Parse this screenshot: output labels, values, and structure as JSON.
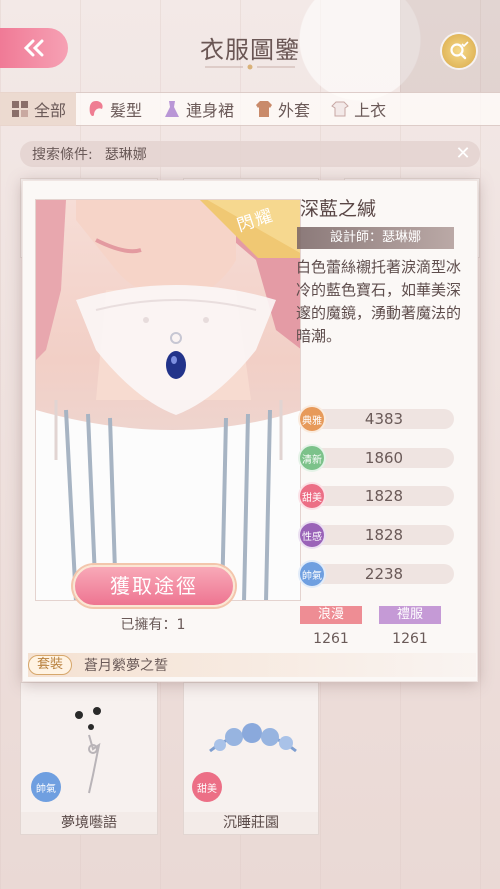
{
  "header": {
    "title": "衣服圖鑒"
  },
  "tabs": [
    {
      "label": "全部",
      "icon": "grid-icon",
      "active": true
    },
    {
      "label": "髮型",
      "icon": "hair-icon",
      "active": false
    },
    {
      "label": "連身裙",
      "icon": "dress-icon",
      "active": false
    },
    {
      "label": "外套",
      "icon": "coat-icon",
      "active": false
    },
    {
      "label": "上衣",
      "icon": "shirt-icon",
      "active": false
    }
  ],
  "search": {
    "label": "搜索條件:",
    "value": "瑟琳娜"
  },
  "background_items": [
    {
      "name": "夢境囈語",
      "badge": "帥氣"
    },
    {
      "name": "沉睡莊園",
      "badge": "甜美"
    }
  ],
  "detail": {
    "ribbon": "閃耀",
    "name": "深藍之緘",
    "designer": "設計師：瑟琳娜",
    "description": "白色蕾絲襯托著淚滴型冰冷的藍色寶石，如華美深邃的魔鏡，湧動著魔法的暗潮。",
    "stats": [
      {
        "icon_label": "典雅",
        "value": "4383",
        "color": "#e79a5a"
      },
      {
        "icon_label": "清新",
        "value": "1860",
        "color": "#7cc28a"
      },
      {
        "icon_label": "甜美",
        "value": "1828",
        "color": "#ec6f86"
      },
      {
        "icon_label": "性感",
        "value": "1828",
        "color": "#9a63b8"
      },
      {
        "icon_label": "帥氣",
        "value": "2238",
        "color": "#6f9fe0"
      }
    ],
    "tags": [
      {
        "label": "浪漫",
        "value": "1261",
        "color": "#ee8d94"
      },
      {
        "label": "禮服",
        "value": "1261",
        "color": "#c59ad6"
      }
    ],
    "acquire_label": "獲取途徑",
    "owned": "已擁有：1",
    "suit_tag": "套裝",
    "suit_name": "蒼月縈夢之誓"
  }
}
